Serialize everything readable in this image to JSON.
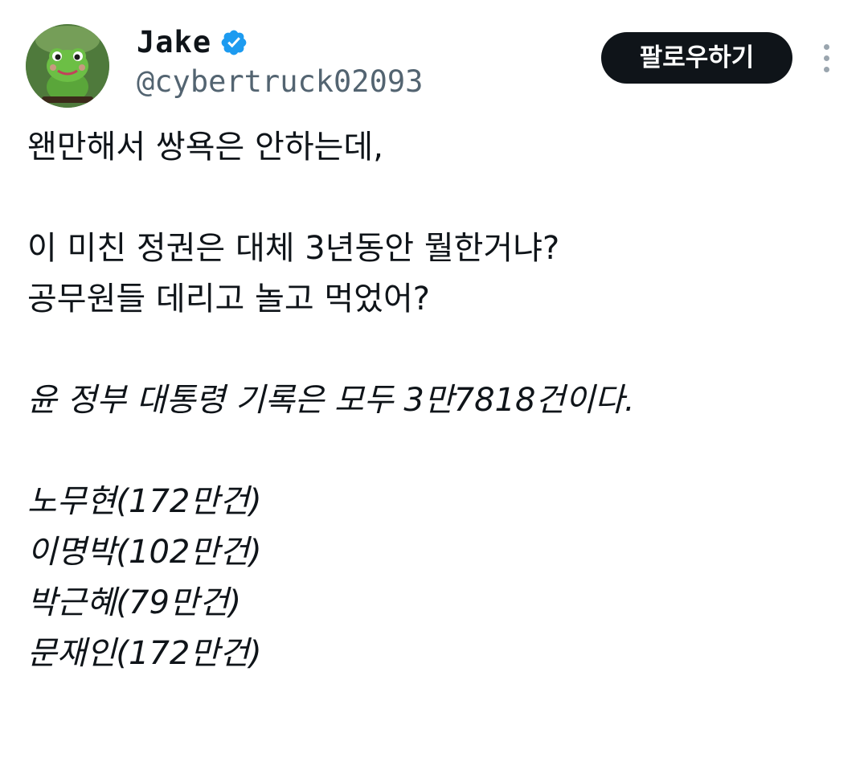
{
  "user": {
    "display_name": "Jake",
    "handle": "@cybertruck02093",
    "verified_icon": "verified-badge-icon",
    "avatar_icon": "frog-avatar"
  },
  "actions": {
    "follow_label": "팔로우하기",
    "more_icon": "more-vertical-icon"
  },
  "tweet": {
    "lines": [
      "왠만해서 쌍욕은 안하는데,",
      "",
      "이 미친 정권은 대체 3년동안 뭘한거냐?",
      "공무원들 데리고 놀고 먹었어?",
      "",
      "윤 정부 대통령 기록은 모두 3만7818건이다.",
      "",
      "노무현(172만건)",
      "이명박(102만건)",
      "박근혜(79만건)",
      "문재인(172만건)"
    ]
  },
  "colors": {
    "text": "#0f1419",
    "secondary": "#536471",
    "verified": "#1d9bf0",
    "button_bg": "#0f1419",
    "button_text": "#ffffff"
  }
}
